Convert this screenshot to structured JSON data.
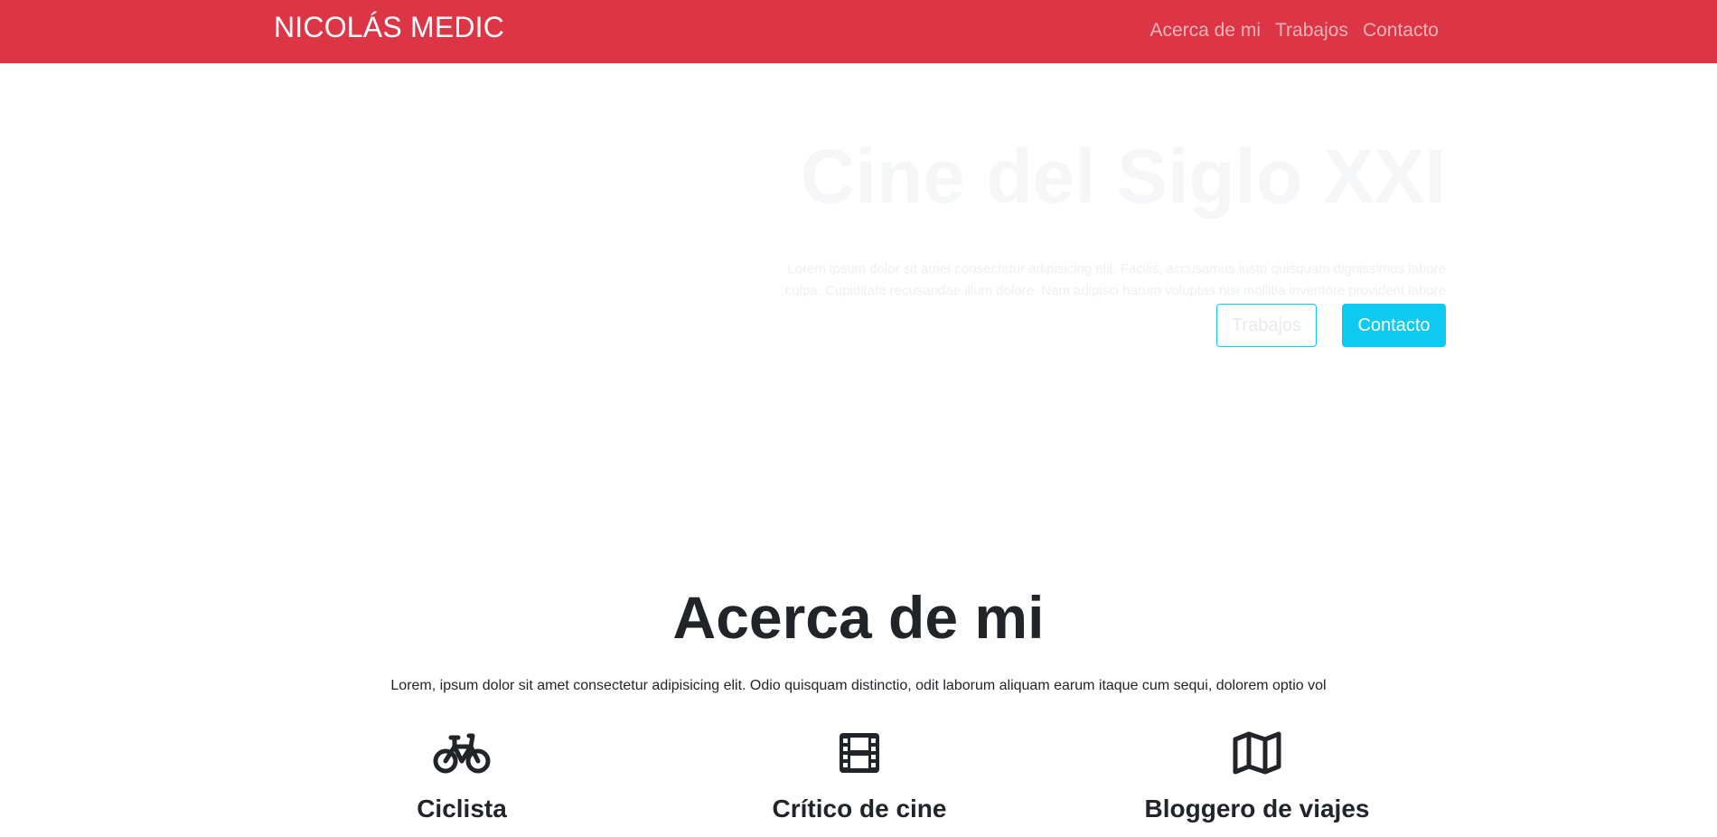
{
  "navbar": {
    "brand": "NICOLÁS MEDIC",
    "links": [
      "Acerca de mi",
      "Trabajos",
      "Contacto"
    ],
    "background_color": "#dc3545"
  },
  "hero": {
    "title": "Cine del Siglo XXI",
    "text": "Lorem ipsum dolor sit amet consectetur adipisicing elit. Facilis, accusamus iusto quisquam dignissimos labore culpa. Cupiditate recusandae illum dolore. Nam adipisci harum voluptas nisi mollitia inventore provident labore voluptatum iusto.",
    "button_outline": "Trabajos",
    "button_primary": "Contacto",
    "button_color": "#0dcaf0"
  },
  "about": {
    "title": "Acerca de mi",
    "text": "Lorem, ipsum dolor sit amet consectetur adipisicing elit. Odio quisquam distinctio, odit laborum aliquam earum itaque cum sequi, dolorem optio vol",
    "features": [
      {
        "title": "Ciclista",
        "icon": "bicycle-icon"
      },
      {
        "title": "Crítico de cine",
        "icon": "film-icon"
      },
      {
        "title": "Bloggero de viajes",
        "icon": "map-icon"
      }
    ]
  }
}
